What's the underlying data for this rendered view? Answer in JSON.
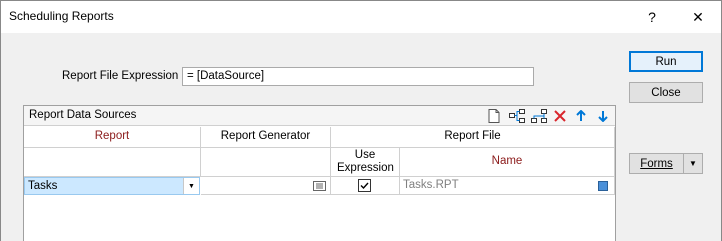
{
  "window": {
    "title": "Scheduling Reports",
    "help_glyph": "?",
    "close_glyph": "✕"
  },
  "report_file_expression": {
    "label": "Report File Expression",
    "value": "=  [DataSource]"
  },
  "buttons": {
    "run": "Run",
    "close": "Close",
    "forms": "Forms"
  },
  "data_sources": {
    "title": "Report Data Sources",
    "toolbar_icons": [
      "new-document-icon",
      "insert-row-icon",
      "append-row-icon",
      "delete-icon",
      "move-up-icon",
      "move-down-icon"
    ],
    "columns": {
      "report": "Report",
      "report_generator": "Report Generator",
      "report_file": "Report File",
      "use_expression": "Use Expression",
      "name": "Name"
    },
    "rows": [
      {
        "report": "Tasks",
        "report_generator": "",
        "use_expression": true,
        "name": "Tasks.RPT"
      }
    ]
  },
  "colors": {
    "accent": "#0078d7",
    "selection": "#cce8ff",
    "header_red": "#8b1a1a",
    "delete_red": "#d9262c"
  }
}
